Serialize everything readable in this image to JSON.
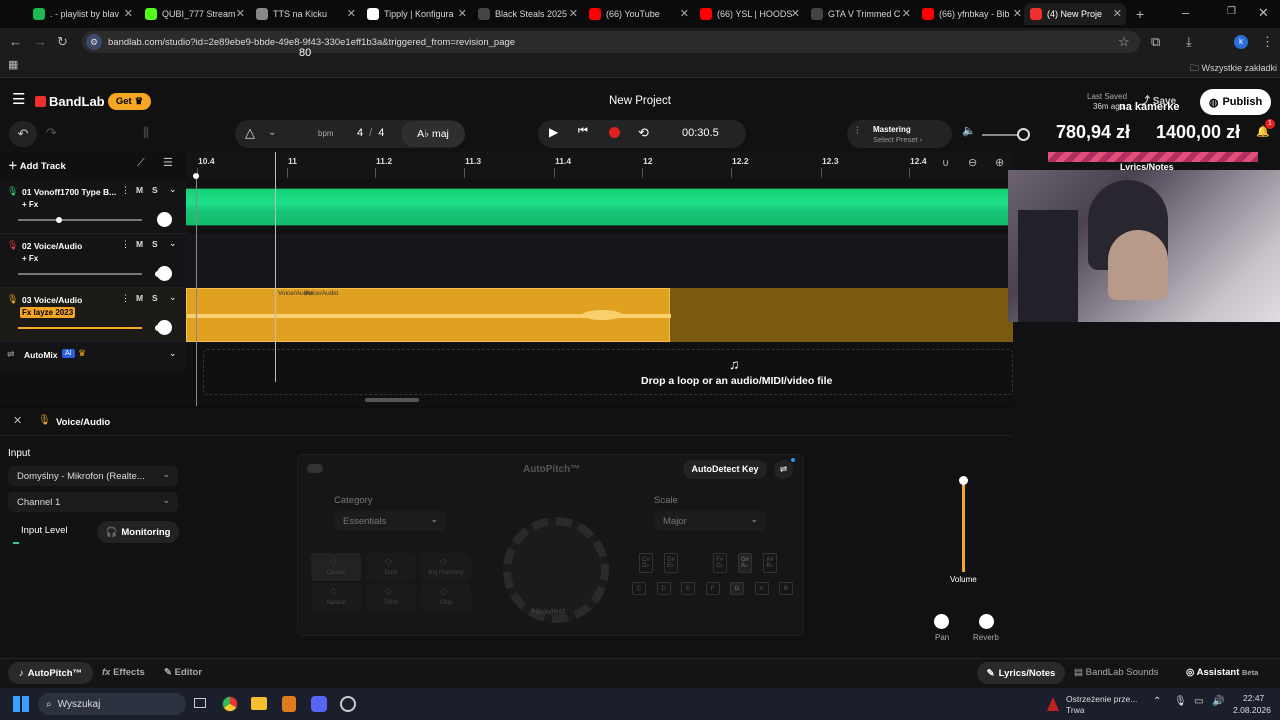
{
  "browser": {
    "tabs": [
      {
        "title": ". - playlist by blav",
        "favicon": "spotify-icon",
        "color": "#1db954"
      },
      {
        "title": "QUBI_777 Stream",
        "favicon": "kick-icon",
        "color": "#53fc18"
      },
      {
        "title": "TTS na Kicku",
        "favicon": "tts-icon",
        "color": "#888"
      },
      {
        "title": "Tipply | Konfigura",
        "favicon": "tipply-icon",
        "color": "#fff"
      },
      {
        "title": "Black Steals 2025",
        "favicon": "page-icon",
        "color": "#444"
      },
      {
        "title": "(66) YouTube",
        "favicon": "youtube-icon",
        "color": "#ff0000"
      },
      {
        "title": "(66) YSL | HOODS",
        "favicon": "youtube-icon",
        "color": "#ff0000"
      },
      {
        "title": "GTA V Trimmed C",
        "favicon": "page-icon",
        "color": "#444"
      },
      {
        "title": "(66) yfnbkay - Bib",
        "favicon": "youtube-icon",
        "color": "#ff0000"
      },
      {
        "title": "(4) New Proje",
        "favicon": "bandlab-icon",
        "color": "#f03030"
      }
    ],
    "url": "bandlab.com/studio?id=2e89ebe9-bbde-49e8-9f43-330e1eff1b3a&triggered_from=revision_page",
    "bookmarks_all": "Wszystkie zakładki"
  },
  "app": {
    "brand": "BandLab",
    "get_label": "Get",
    "project_title": "New Project",
    "last_saved": "Last Saved",
    "last_saved_ago": "36m ago",
    "save_label": "Save",
    "publish_label": "Publish",
    "overlay_camera": "na kamerke",
    "overlay_amount1": "780,94 zł",
    "overlay_amount2": "1400,00 zł",
    "overlay_lyrics": "Lyrics/Notes",
    "notif_count": "1"
  },
  "transport": {
    "bpm": "80",
    "bpm_unit": "bpm",
    "sig_top": "4",
    "sig_sep": "/",
    "sig_bottom": "4",
    "key": "A♭ maj",
    "time": "00:30.5",
    "mastering": "Mastering",
    "select_preset": "Select Preset"
  },
  "tracks": {
    "add_track": "Add Track",
    "ruler": [
      "10.4",
      "11",
      "11.2",
      "11.3",
      "11.4",
      "12",
      "12.2",
      "12.3",
      "12.4"
    ],
    "list": [
      {
        "num": "01",
        "name": "Vonoff1700 Type B...",
        "fx": "+ Fx",
        "color": "#2bd47a"
      },
      {
        "num": "02",
        "name": "Voice/Audio",
        "fx": "+ Fx",
        "color": "#e04040"
      },
      {
        "num": "03",
        "name": "Voice/Audio",
        "fx": "Fx Iayze 2023",
        "color": "#f5a623"
      }
    ],
    "m": "M",
    "s": "S",
    "clip_label_1": "Voice/Audio",
    "clip_label_2": "Voice/Audio",
    "automix": "AutoMix",
    "ai": "AI",
    "drop_text": "Drop a loop or an audio/MIDI/video file"
  },
  "panel": {
    "title": "Voice/Audio",
    "input_label": "Input",
    "input_device": "Domyślny - Mikrofon (Realte...",
    "channel": "Channel 1",
    "input_level": "Input Level",
    "monitoring": "Monitoring",
    "autopitch_title": "AutoPitch™",
    "autodetect": "AutoDetect Key",
    "category_label": "Category",
    "category_value": "Essentials",
    "scale_label": "Scale",
    "scale_value": "Major",
    "presets": [
      "Classic",
      "Duet",
      "Big Harmony",
      "Natural",
      "Third",
      "Chip"
    ],
    "knob_label": "Heaviest",
    "keys_top": [
      "C#\nD♭",
      "D#\nE♭",
      "F#\nG♭",
      "G#\nA♭",
      "A#\nB♭"
    ],
    "keys_bottom": [
      "C",
      "D",
      "E",
      "F",
      "G",
      "A",
      "B"
    ],
    "volume": "Volume",
    "pan": "Pan",
    "reverb": "Reverb"
  },
  "footer": {
    "autopitch": "AutoPitch™",
    "effects": "Effects",
    "editor": "Editor",
    "lyrics": "Lyrics/Notes",
    "sounds": "BandLab Sounds",
    "assistant": "Assistant",
    "beta": "Beta"
  },
  "taskbar": {
    "search": "Wyszukaj",
    "warning_title": "Ostrzeżenie prze...",
    "warning_sub": "Trwa",
    "time": "22:47",
    "date": "2.08.2026"
  }
}
